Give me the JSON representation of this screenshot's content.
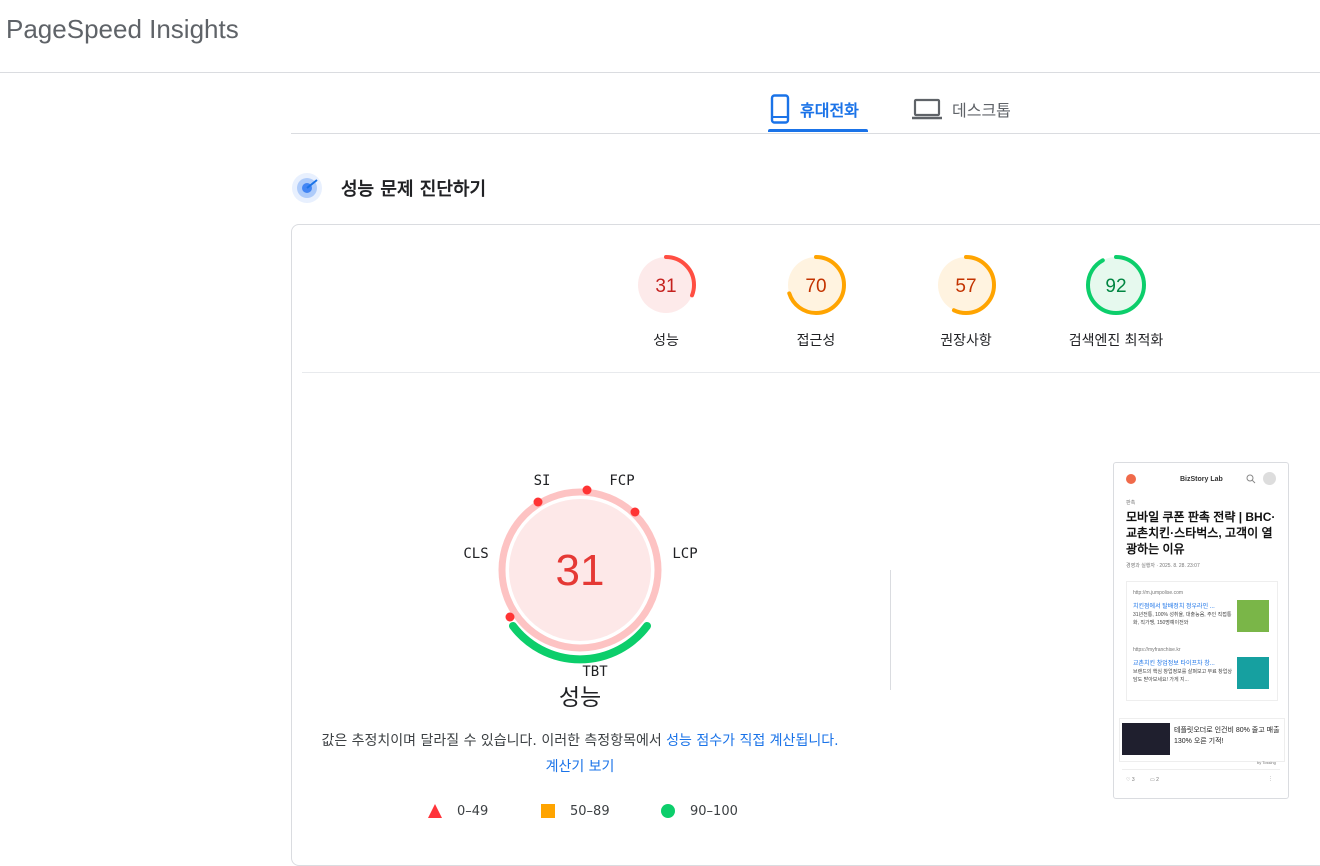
{
  "app": {
    "title": "PageSpeed Insights"
  },
  "tabs": [
    {
      "label": "휴대전화",
      "icon": "mobile-phone-icon",
      "active": true
    },
    {
      "label": "데스크톱",
      "icon": "laptop-icon",
      "active": false
    }
  ],
  "section": {
    "title": "성능 문제 진단하기",
    "icon": "radar-icon"
  },
  "scores": [
    {
      "value": 31,
      "label": "성능",
      "color": "#ff4e42",
      "bg": "#fdeaea"
    },
    {
      "value": 70,
      "label": "접근성",
      "color": "#ffa400",
      "bg": "#fff3e0"
    },
    {
      "value": 57,
      "label": "권장사항",
      "color": "#ffa400",
      "bg": "#fff3e0"
    },
    {
      "value": 92,
      "label": "검색엔진 최적화",
      "color": "#0cce6b",
      "bg": "#e6f9ee"
    }
  ],
  "performance": {
    "score": 31,
    "label": "성능",
    "metrics": {
      "si": "SI",
      "fcp": "FCP",
      "lcp": "LCP",
      "tbt": "TBT",
      "cls": "CLS"
    },
    "note_prefix": "값은 추정치이며 달라질 수 있습니다. 이러한 측정항목에서 ",
    "note_link1": "성능 점수가 직접 계산됩니다.",
    "note_link2": "계산기 보기"
  },
  "legend": [
    {
      "range": "0–49",
      "shape": "triangle",
      "color": "#ff333a"
    },
    {
      "range": "50–89",
      "shape": "square",
      "color": "#ffa400"
    },
    {
      "range": "90–100",
      "shape": "circle",
      "color": "#0cce6b"
    }
  ],
  "screenshot": {
    "brand": "BizStory Lab",
    "category": "판촉",
    "title": "모바일 쿠폰 판촉 전략 | BHC·교촌치킨·스타벅스, 고객이 열광하는 이유",
    "byline": "경영과 실행자 · 2025. 8. 28. 23:07",
    "ad1_url": "http://m.jumpolise.com",
    "ad1_title": "치킨점에서 탈배정치 정우라인 ...",
    "ad1_desc": "31년전통, 100% 성취율, 대출능음, 주인 직접통화, 직가맹, 150명예이전와",
    "ad2_url": "https://myfranchise.kr",
    "ad2_title": "교촌치킨 창업정보 타이프차 창...",
    "ad2_desc": "브랜드의 핵심 창업정보를 살펴보고 무료 창업상담도 받아보세요! 가게 지...",
    "ad3_text": "테플릿오더로 인건비 80% 줄고 매출 130% 오른 기적!",
    "ad3_by": "by Tossing",
    "likes": "3",
    "comments": "2"
  }
}
